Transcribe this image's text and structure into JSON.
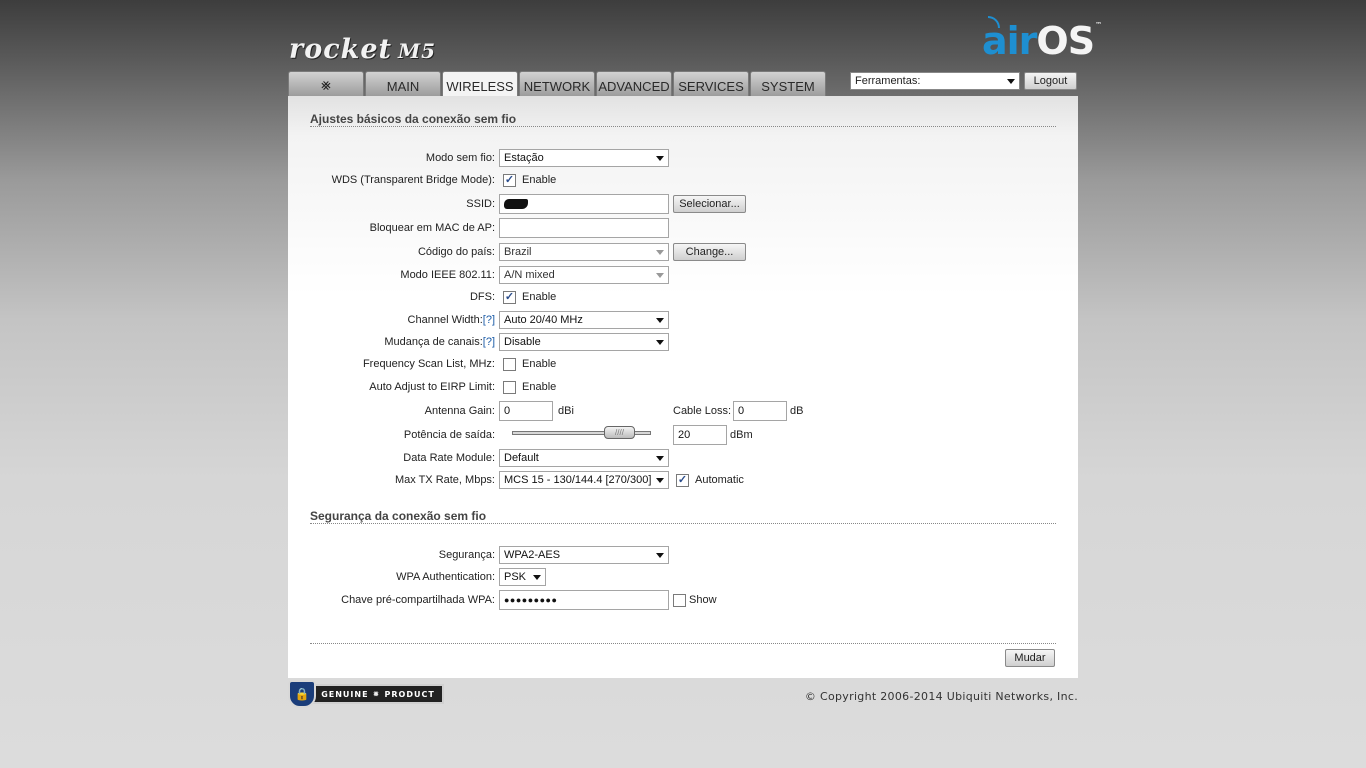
{
  "brand": {
    "product": "rocket",
    "model": "M5",
    "os_air": "air",
    "os_os": "OS",
    "os_tm": "™"
  },
  "tabs": [
    {
      "label": "⨳",
      "icon": "ubiquiti-logo-icon"
    },
    {
      "label": "MAIN"
    },
    {
      "label": "WIRELESS",
      "active": true
    },
    {
      "label": "NETWORK"
    },
    {
      "label": "ADVANCED"
    },
    {
      "label": "SERVICES"
    },
    {
      "label": "SYSTEM"
    }
  ],
  "tools": {
    "selected": "Ferramentas:"
  },
  "logout_label": "Logout",
  "basic": {
    "title": "Ajustes básicos da conexão sem fio",
    "wireless_mode": {
      "label": "Modo sem fio:",
      "value": "Estação"
    },
    "wds": {
      "label": "WDS (Transparent Bridge Mode):",
      "checkbox": "Enable",
      "checked": true
    },
    "ssid": {
      "label": "SSID:",
      "value": "",
      "button": "Selecionar..."
    },
    "lock_ap_mac": {
      "label": "Bloquear em MAC de AP:",
      "value": ""
    },
    "country": {
      "label": "Código do país:",
      "value": "Brazil",
      "button": "Change..."
    },
    "ieee_mode": {
      "label": "Modo IEEE 802.11:",
      "value": "A/N mixed"
    },
    "dfs": {
      "label": "DFS:",
      "checkbox": "Enable",
      "checked": true
    },
    "channel_width": {
      "label": "Channel Width:",
      "help": "[?]",
      "value": "Auto 20/40 MHz"
    },
    "channel_shift": {
      "label": "Mudança de canais:",
      "help": "[?]",
      "value": "Disable"
    },
    "freq_scan": {
      "label": "Frequency Scan List, MHz:",
      "checkbox": "Enable",
      "checked": false
    },
    "auto_eirp": {
      "label": "Auto Adjust to EIRP Limit:",
      "checkbox": "Enable",
      "checked": false
    },
    "antenna_gain": {
      "label": "Antenna Gain:",
      "value": "0",
      "unit": "dBi"
    },
    "cable_loss": {
      "label": "Cable Loss:",
      "value": "0",
      "unit": "dB"
    },
    "output_power": {
      "label": "Potência de saída:",
      "value": "20",
      "unit": "dBm",
      "level": 0.75
    },
    "data_rate_module": {
      "label": "Data Rate Module:",
      "value": "Default"
    },
    "max_tx_rate": {
      "label": "Max TX Rate, Mbps:",
      "value": "MCS 15 - 130/144.4 [270/300]",
      "checkbox": "Automatic",
      "checked": true
    }
  },
  "security": {
    "title": "Segurança da conexão sem fio",
    "security": {
      "label": "Segurança:",
      "value": "WPA2-AES"
    },
    "wpa_auth": {
      "label": "WPA Authentication:",
      "value": "PSK"
    },
    "psk": {
      "label": "Chave pré-compartilhada WPA:",
      "value": "●●●●●●●●●",
      "checkbox": "Show",
      "checked": false
    }
  },
  "submit_label": "Mudar",
  "footer": {
    "genuine_left": "GENUINE",
    "genuine_right": "PRODUCT",
    "copyright": "© Copyright 2006-2014 Ubiquiti Networks, Inc."
  }
}
